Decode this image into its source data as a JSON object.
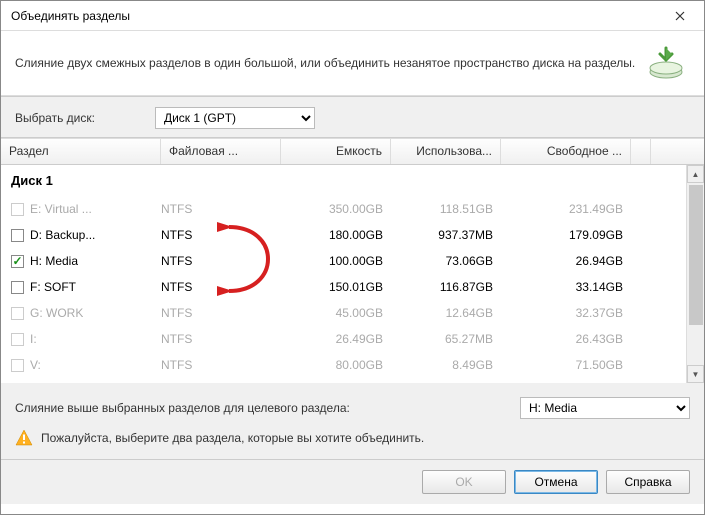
{
  "window": {
    "title": "Объединять разделы"
  },
  "description": "Слияние двух смежных разделов в один большой, или объединить незанятое пространство диска на разделы.",
  "diskSelector": {
    "label": "Выбрать диск:",
    "value": "Диск 1 (GPT)"
  },
  "columns": {
    "partition": "Раздел",
    "filesystem": "Файловая ...",
    "capacity": "Емкость",
    "used": "Использова...",
    "free": "Свободное ..."
  },
  "diskGroup": "Диск 1",
  "rows": [
    {
      "checked": false,
      "enabled": false,
      "name": "E: Virtual ...",
      "fs": "NTFS",
      "cap": "350.00GB",
      "used": "118.51GB",
      "free": "231.49GB"
    },
    {
      "checked": false,
      "enabled": true,
      "name": "D: Backup...",
      "fs": "NTFS",
      "cap": "180.00GB",
      "used": "937.37MB",
      "free": "179.09GB"
    },
    {
      "checked": true,
      "enabled": true,
      "name": "H: Media",
      "fs": "NTFS",
      "cap": "100.00GB",
      "used": "73.06GB",
      "free": "26.94GB"
    },
    {
      "checked": false,
      "enabled": true,
      "name": "F: SOFT",
      "fs": "NTFS",
      "cap": "150.01GB",
      "used": "116.87GB",
      "free": "33.14GB"
    },
    {
      "checked": false,
      "enabled": false,
      "name": "G: WORK",
      "fs": "NTFS",
      "cap": "45.00GB",
      "used": "12.64GB",
      "free": "32.37GB"
    },
    {
      "checked": false,
      "enabled": false,
      "name": "I:",
      "fs": "NTFS",
      "cap": "26.49GB",
      "used": "65.27MB",
      "free": "26.43GB"
    },
    {
      "checked": false,
      "enabled": false,
      "name": "V:",
      "fs": "NTFS",
      "cap": "80.00GB",
      "used": "8.49GB",
      "free": "71.50GB"
    }
  ],
  "target": {
    "label": "Слияние выше выбранных разделов для целевого раздела:",
    "value": "H: Media"
  },
  "warning": "Пожалуйста, выберите два раздела, которые вы хотите объединить.",
  "buttons": {
    "ok": "OK",
    "cancel": "Отмена",
    "help": "Справка"
  }
}
